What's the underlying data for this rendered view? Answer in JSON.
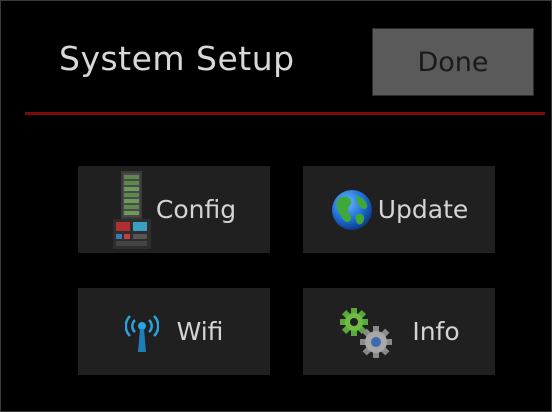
{
  "header": {
    "title": "System Setup",
    "done_label": "Done"
  },
  "tiles": [
    {
      "label": "Config",
      "icon": "server-rack-icon"
    },
    {
      "label": "Update",
      "icon": "globe-icon"
    },
    {
      "label": "Wifi",
      "icon": "wifi-antenna-icon"
    },
    {
      "label": "Info",
      "icon": "gears-icon"
    }
  ],
  "colors": {
    "background": "#000000",
    "divider": "#7a0b0b",
    "tile": "#202020",
    "done_button": "#5a5a5a",
    "text": "#d8d8d8"
  }
}
